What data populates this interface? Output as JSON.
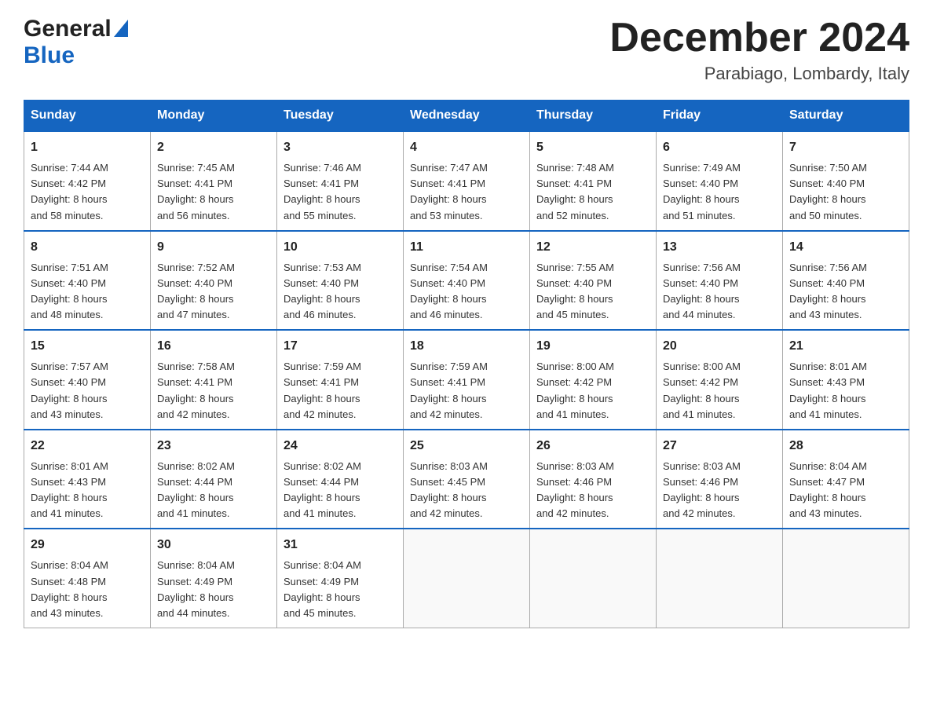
{
  "logo": {
    "general": "General",
    "blue": "Blue"
  },
  "title": {
    "month_year": "December 2024",
    "location": "Parabiago, Lombardy, Italy"
  },
  "header_days": [
    "Sunday",
    "Monday",
    "Tuesday",
    "Wednesday",
    "Thursday",
    "Friday",
    "Saturday"
  ],
  "weeks": [
    [
      {
        "day": "1",
        "sunrise": "7:44 AM",
        "sunset": "4:42 PM",
        "daylight": "8 hours and 58 minutes."
      },
      {
        "day": "2",
        "sunrise": "7:45 AM",
        "sunset": "4:41 PM",
        "daylight": "8 hours and 56 minutes."
      },
      {
        "day": "3",
        "sunrise": "7:46 AM",
        "sunset": "4:41 PM",
        "daylight": "8 hours and 55 minutes."
      },
      {
        "day": "4",
        "sunrise": "7:47 AM",
        "sunset": "4:41 PM",
        "daylight": "8 hours and 53 minutes."
      },
      {
        "day": "5",
        "sunrise": "7:48 AM",
        "sunset": "4:41 PM",
        "daylight": "8 hours and 52 minutes."
      },
      {
        "day": "6",
        "sunrise": "7:49 AM",
        "sunset": "4:40 PM",
        "daylight": "8 hours and 51 minutes."
      },
      {
        "day": "7",
        "sunrise": "7:50 AM",
        "sunset": "4:40 PM",
        "daylight": "8 hours and 50 minutes."
      }
    ],
    [
      {
        "day": "8",
        "sunrise": "7:51 AM",
        "sunset": "4:40 PM",
        "daylight": "8 hours and 48 minutes."
      },
      {
        "day": "9",
        "sunrise": "7:52 AM",
        "sunset": "4:40 PM",
        "daylight": "8 hours and 47 minutes."
      },
      {
        "day": "10",
        "sunrise": "7:53 AM",
        "sunset": "4:40 PM",
        "daylight": "8 hours and 46 minutes."
      },
      {
        "day": "11",
        "sunrise": "7:54 AM",
        "sunset": "4:40 PM",
        "daylight": "8 hours and 46 minutes."
      },
      {
        "day": "12",
        "sunrise": "7:55 AM",
        "sunset": "4:40 PM",
        "daylight": "8 hours and 45 minutes."
      },
      {
        "day": "13",
        "sunrise": "7:56 AM",
        "sunset": "4:40 PM",
        "daylight": "8 hours and 44 minutes."
      },
      {
        "day": "14",
        "sunrise": "7:56 AM",
        "sunset": "4:40 PM",
        "daylight": "8 hours and 43 minutes."
      }
    ],
    [
      {
        "day": "15",
        "sunrise": "7:57 AM",
        "sunset": "4:40 PM",
        "daylight": "8 hours and 43 minutes."
      },
      {
        "day": "16",
        "sunrise": "7:58 AM",
        "sunset": "4:41 PM",
        "daylight": "8 hours and 42 minutes."
      },
      {
        "day": "17",
        "sunrise": "7:59 AM",
        "sunset": "4:41 PM",
        "daylight": "8 hours and 42 minutes."
      },
      {
        "day": "18",
        "sunrise": "7:59 AM",
        "sunset": "4:41 PM",
        "daylight": "8 hours and 42 minutes."
      },
      {
        "day": "19",
        "sunrise": "8:00 AM",
        "sunset": "4:42 PM",
        "daylight": "8 hours and 41 minutes."
      },
      {
        "day": "20",
        "sunrise": "8:00 AM",
        "sunset": "4:42 PM",
        "daylight": "8 hours and 41 minutes."
      },
      {
        "day": "21",
        "sunrise": "8:01 AM",
        "sunset": "4:43 PM",
        "daylight": "8 hours and 41 minutes."
      }
    ],
    [
      {
        "day": "22",
        "sunrise": "8:01 AM",
        "sunset": "4:43 PM",
        "daylight": "8 hours and 41 minutes."
      },
      {
        "day": "23",
        "sunrise": "8:02 AM",
        "sunset": "4:44 PM",
        "daylight": "8 hours and 41 minutes."
      },
      {
        "day": "24",
        "sunrise": "8:02 AM",
        "sunset": "4:44 PM",
        "daylight": "8 hours and 41 minutes."
      },
      {
        "day": "25",
        "sunrise": "8:03 AM",
        "sunset": "4:45 PM",
        "daylight": "8 hours and 42 minutes."
      },
      {
        "day": "26",
        "sunrise": "8:03 AM",
        "sunset": "4:46 PM",
        "daylight": "8 hours and 42 minutes."
      },
      {
        "day": "27",
        "sunrise": "8:03 AM",
        "sunset": "4:46 PM",
        "daylight": "8 hours and 42 minutes."
      },
      {
        "day": "28",
        "sunrise": "8:04 AM",
        "sunset": "4:47 PM",
        "daylight": "8 hours and 43 minutes."
      }
    ],
    [
      {
        "day": "29",
        "sunrise": "8:04 AM",
        "sunset": "4:48 PM",
        "daylight": "8 hours and 43 minutes."
      },
      {
        "day": "30",
        "sunrise": "8:04 AM",
        "sunset": "4:49 PM",
        "daylight": "8 hours and 44 minutes."
      },
      {
        "day": "31",
        "sunrise": "8:04 AM",
        "sunset": "4:49 PM",
        "daylight": "8 hours and 45 minutes."
      },
      null,
      null,
      null,
      null
    ]
  ],
  "labels": {
    "sunrise": "Sunrise: ",
    "sunset": "Sunset: ",
    "daylight": "Daylight: "
  }
}
